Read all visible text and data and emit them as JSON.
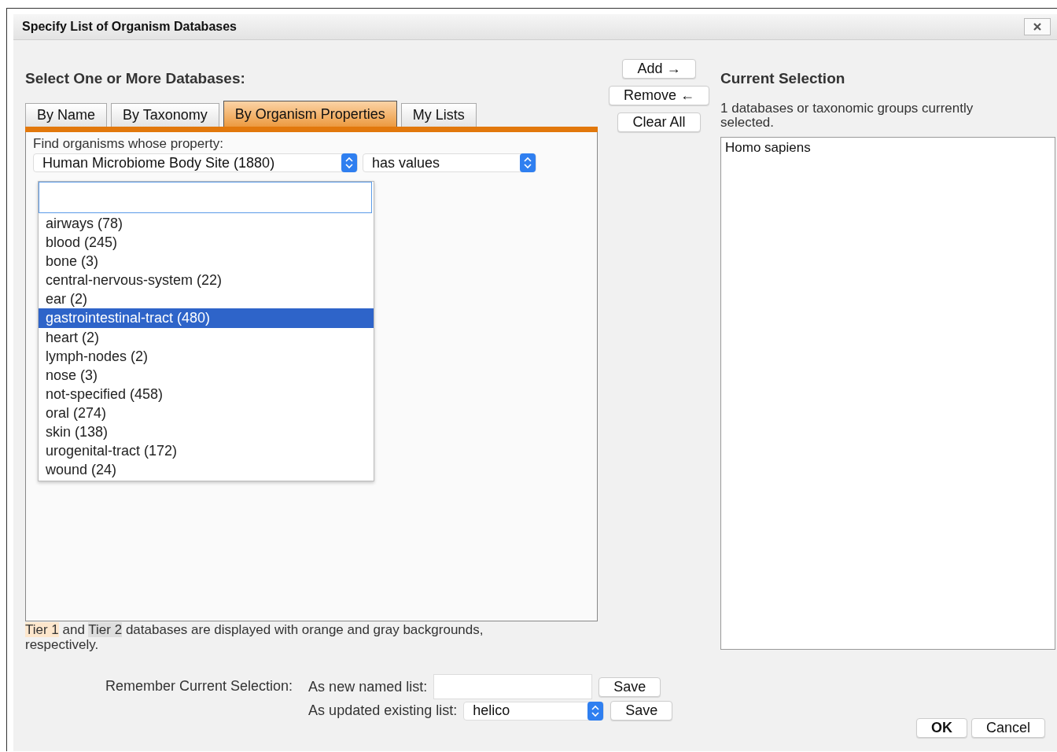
{
  "window": {
    "title": "Specify List of Organism Databases"
  },
  "heading": "Select One or More Databases:",
  "tabs": [
    {
      "label": "By Name",
      "selected": false
    },
    {
      "label": "By Taxonomy",
      "selected": false
    },
    {
      "label": "By Organism Properties",
      "selected": true
    },
    {
      "label": "My Lists",
      "selected": false
    }
  ],
  "property_filter": {
    "label": "Find organisms whose property:",
    "property": "Human Microbiome Body Site (1880)",
    "condition": "has values"
  },
  "dropdown": {
    "expanded": true,
    "items": [
      {
        "label": "airways (78)",
        "selected": false
      },
      {
        "label": "blood (245)",
        "selected": false
      },
      {
        "label": "bone (3)",
        "selected": false
      },
      {
        "label": "central-nervous-system (22)",
        "selected": false
      },
      {
        "label": "ear (2)",
        "selected": false
      },
      {
        "label": "gastrointestinal-tract (480)",
        "selected": true
      },
      {
        "label": "heart (2)",
        "selected": false
      },
      {
        "label": "lymph-nodes (2)",
        "selected": false
      },
      {
        "label": "nose (3)",
        "selected": false
      },
      {
        "label": "not-specified (458)",
        "selected": false
      },
      {
        "label": "oral (274)",
        "selected": false
      },
      {
        "label": "skin (138)",
        "selected": false
      },
      {
        "label": "urogenital-tract (172)",
        "selected": false
      },
      {
        "label": "wound (24)",
        "selected": false
      }
    ]
  },
  "legend": [
    {
      "text": "Tier 1",
      "color": "#fde6cc"
    },
    {
      "text": " and "
    },
    {
      "text": "Tier 2",
      "color": "#dedede"
    },
    {
      "text": " databases are displayed with orange and gray backgrounds, respectively."
    }
  ],
  "transfer_buttons": [
    "Add →",
    "Remove ←",
    "Clear All"
  ],
  "current_selection": {
    "heading": "Current Selection",
    "summary": "1 databases or taxonomic groups currently selected.",
    "items": [
      "Homo sapiens"
    ]
  },
  "remember": {
    "label": "Remember Current Selection:",
    "new_list_label": "As new named list:",
    "new_list_save": "Save",
    "existing_list_label": "As updated existing list:",
    "existing_list": "helico",
    "existing_list_save": "Save"
  },
  "buttons": [
    {
      "label": "OK",
      "kind": "default"
    },
    {
      "label": "Cancel",
      "kind": "normal"
    }
  ]
}
